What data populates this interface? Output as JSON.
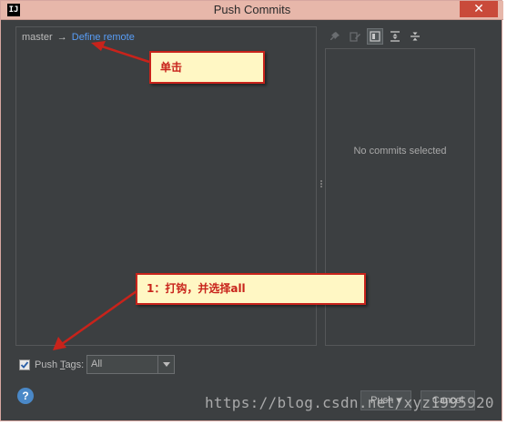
{
  "window": {
    "title": "Push Commits",
    "app_icon_text": "IJ",
    "close_label": "✕"
  },
  "branch": {
    "source": "master",
    "arrow": "→",
    "target_link": "Define remote"
  },
  "toolbar": {
    "icons": [
      "pin-icon",
      "edit-icon",
      "show-details-icon",
      "expand-all-icon",
      "collapse-all-icon"
    ]
  },
  "details": {
    "empty_message": "No commits selected"
  },
  "push_tags": {
    "label_prefix": "Push ",
    "label_mnemonic": "T",
    "label_suffix": "ags:",
    "checked": true,
    "selected_option": "All"
  },
  "footer": {
    "help_label": "?",
    "push_label": "Push ▾",
    "cancel_label": "Cancel"
  },
  "annotations": {
    "callout_1": "单击",
    "callout_2": "1：打钩，并选择all",
    "color": "#c8231b"
  },
  "watermark": "https://blog.csdn.net/xyz1995920",
  "colors": {
    "dialog_bg": "#3c3f41",
    "link": "#589df6",
    "titlebar": "#e7b7aa"
  }
}
